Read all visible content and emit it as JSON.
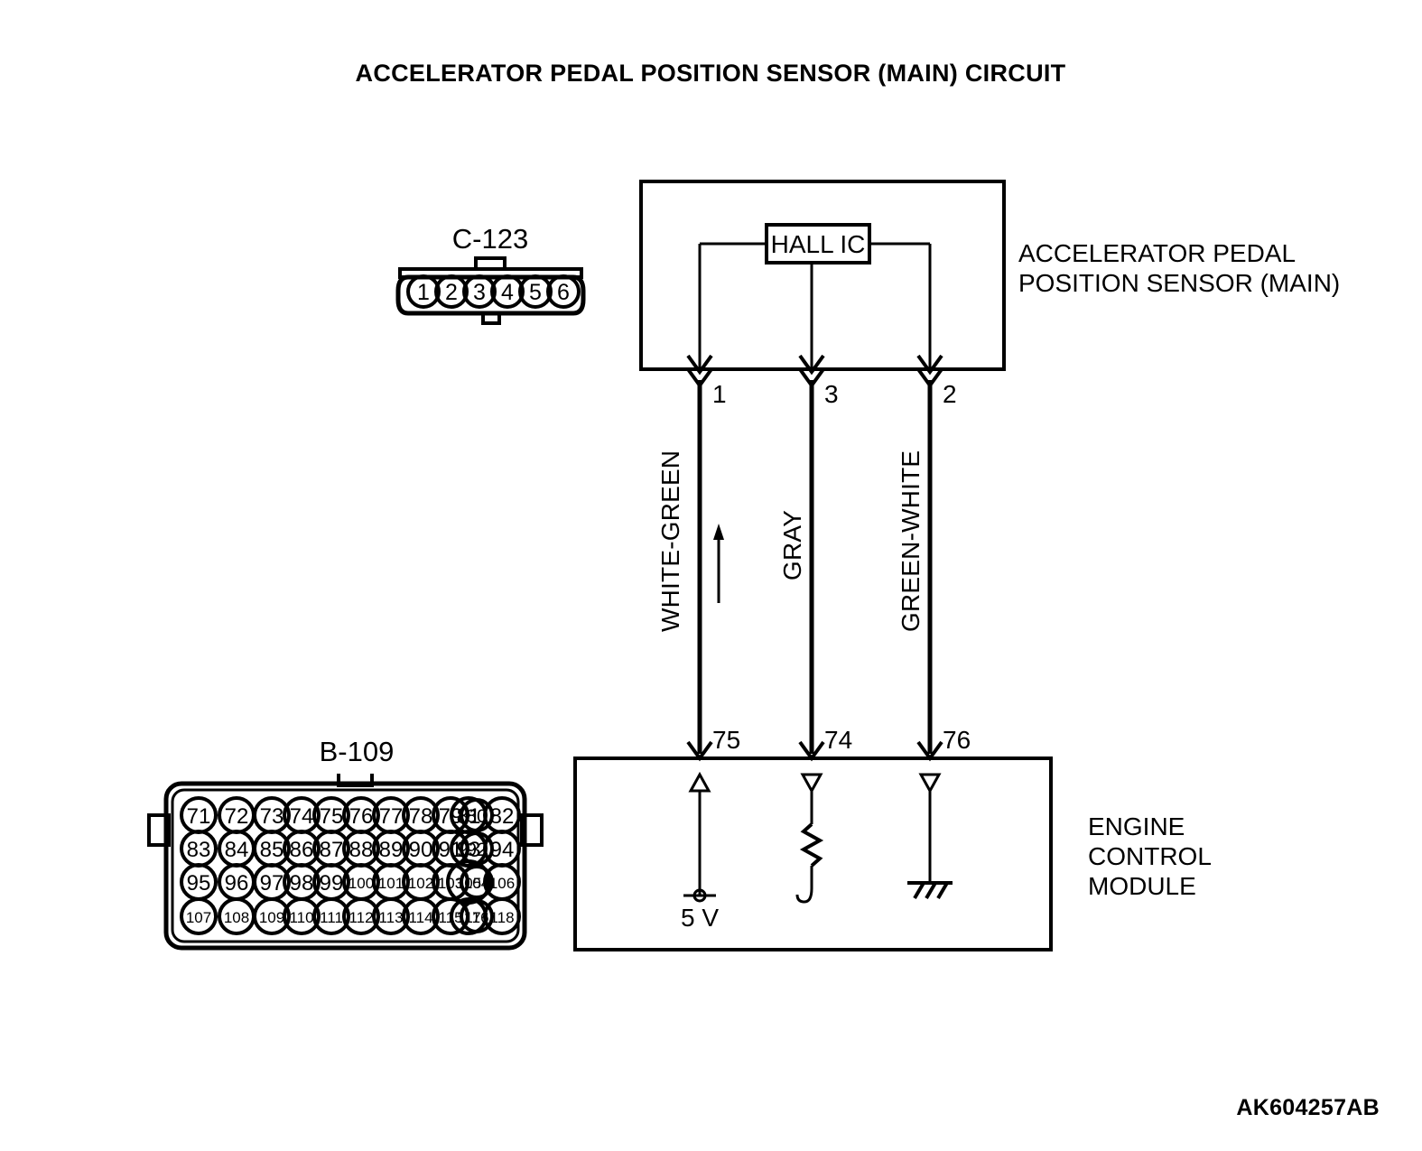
{
  "title": "ACCELERATOR PEDAL POSITION SENSOR (MAIN) CIRCUIT",
  "reference_code": "AK604257AB",
  "sensor_connector": {
    "name": "C-123",
    "pins": [
      "1",
      "2",
      "3",
      "4",
      "5",
      "6"
    ]
  },
  "sensor_block": {
    "label_line1": "ACCELERATOR PEDAL",
    "label_line2": "POSITION SENSOR (MAIN)",
    "component": "HALL IC",
    "pins": [
      "1",
      "3",
      "2"
    ]
  },
  "wires": [
    {
      "color_label": "WHITE-GREEN",
      "sensor_pin": "1",
      "ecm_pin": "75",
      "has_direction_arrow": true
    },
    {
      "color_label": "GRAY",
      "sensor_pin": "3",
      "ecm_pin": "74",
      "has_direction_arrow": false
    },
    {
      "color_label": "GREEN-WHITE",
      "sensor_pin": "2",
      "ecm_pin": "76",
      "has_direction_arrow": false
    }
  ],
  "ecm_block": {
    "label_line1": "ENGINE",
    "label_line2": "CONTROL",
    "label_line3": "MODULE",
    "supply_label": "5 V",
    "internals": [
      {
        "pin": "75",
        "symbol": "voltage-source-terminal",
        "value": "5 V"
      },
      {
        "pin": "74",
        "symbol": "pull-up-resistor"
      },
      {
        "pin": "76",
        "symbol": "chassis-ground"
      }
    ]
  },
  "ecm_connector": {
    "name": "B-109",
    "rows": [
      [
        "71",
        "72",
        "73",
        "74",
        "75",
        "76",
        "77",
        "78",
        "79",
        "80",
        "81",
        "82"
      ],
      [
        "83",
        "84",
        "85",
        "86",
        "87",
        "88",
        "89",
        "90",
        "91",
        "92",
        "93",
        "94"
      ],
      [
        "95",
        "96",
        "97",
        "98",
        "99",
        "100",
        "101",
        "102",
        "103",
        "104",
        "105",
        "106"
      ],
      [
        "107",
        "108",
        "109",
        "110",
        "111",
        "112",
        "113",
        "114",
        "115",
        "116",
        "117",
        "118"
      ]
    ]
  },
  "colors": {
    "ink": "#000000",
    "background": "#ffffff"
  }
}
